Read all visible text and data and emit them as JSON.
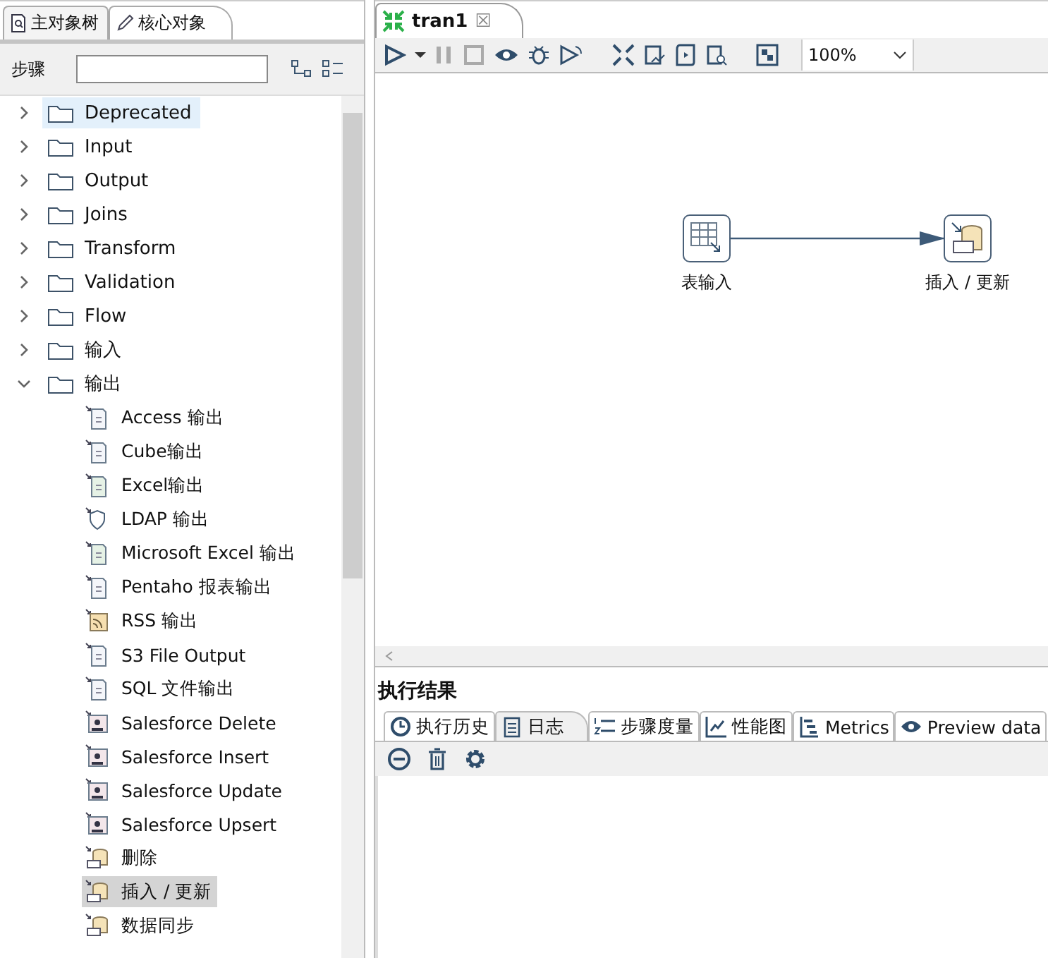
{
  "left_panel": {
    "tabs": [
      {
        "label": "主对象树",
        "selected": false
      },
      {
        "label": "核心对象",
        "selected": true
      }
    ],
    "search": {
      "label": "步骤"
    },
    "tree": [
      {
        "label": "Deprecated",
        "expanded": false,
        "hovered": true
      },
      {
        "label": "Input",
        "expanded": false,
        "hovered": false
      },
      {
        "label": "Output",
        "expanded": false,
        "hovered": false
      },
      {
        "label": "Joins",
        "expanded": false,
        "hovered": false
      },
      {
        "label": "Transform",
        "expanded": false,
        "hovered": false
      },
      {
        "label": "Validation",
        "expanded": false,
        "hovered": false
      },
      {
        "label": "Flow",
        "expanded": false,
        "hovered": false
      },
      {
        "label": "输入",
        "expanded": false,
        "hovered": false
      },
      {
        "label": "输出",
        "expanded": true,
        "hovered": false,
        "children": [
          {
            "label": "Access 输出",
            "kind": "doc",
            "selected": false
          },
          {
            "label": "Cube输出",
            "kind": "doc",
            "selected": false
          },
          {
            "label": "Excel输出",
            "kind": "sheet",
            "selected": false
          },
          {
            "label": "LDAP 输出",
            "kind": "shield",
            "selected": false
          },
          {
            "label": "Microsoft Excel 输出",
            "kind": "sheet",
            "selected": false
          },
          {
            "label": "Pentaho 报表输出",
            "kind": "doc",
            "selected": false
          },
          {
            "label": "RSS 输出",
            "kind": "feed",
            "selected": false
          },
          {
            "label": "S3 File Output",
            "kind": "doc",
            "selected": false
          },
          {
            "label": "SQL 文件输出",
            "kind": "doc",
            "selected": false
          },
          {
            "label": "Salesforce Delete",
            "kind": "person",
            "selected": false
          },
          {
            "label": "Salesforce Insert",
            "kind": "person",
            "selected": false
          },
          {
            "label": "Salesforce Update",
            "kind": "person",
            "selected": false
          },
          {
            "label": "Salesforce Upsert",
            "kind": "person",
            "selected": false
          },
          {
            "label": "删除",
            "kind": "database",
            "selected": false
          },
          {
            "label": "插入 / 更新",
            "kind": "database",
            "selected": true
          },
          {
            "label": "数据同步",
            "kind": "database",
            "selected": false
          }
        ]
      }
    ]
  },
  "editor": {
    "tabs": [
      {
        "label": "tran1",
        "close": "☒",
        "selected": true
      }
    ],
    "zoom": {
      "value": "100%"
    },
    "canvas": {
      "nodes": [
        {
          "label": "表输入",
          "kind": "table"
        },
        {
          "label": "插入 / 更新",
          "kind": "database"
        }
      ]
    }
  },
  "results": {
    "title": "执行结果",
    "tabs": [
      {
        "label": "执行历史",
        "selected": false
      },
      {
        "label": "日志",
        "selected": true
      },
      {
        "label": "步骤度量",
        "selected": false
      },
      {
        "label": "性能图",
        "selected": false
      },
      {
        "label": "Metrics",
        "selected": false
      },
      {
        "label": "Preview data",
        "selected": false
      }
    ]
  }
}
